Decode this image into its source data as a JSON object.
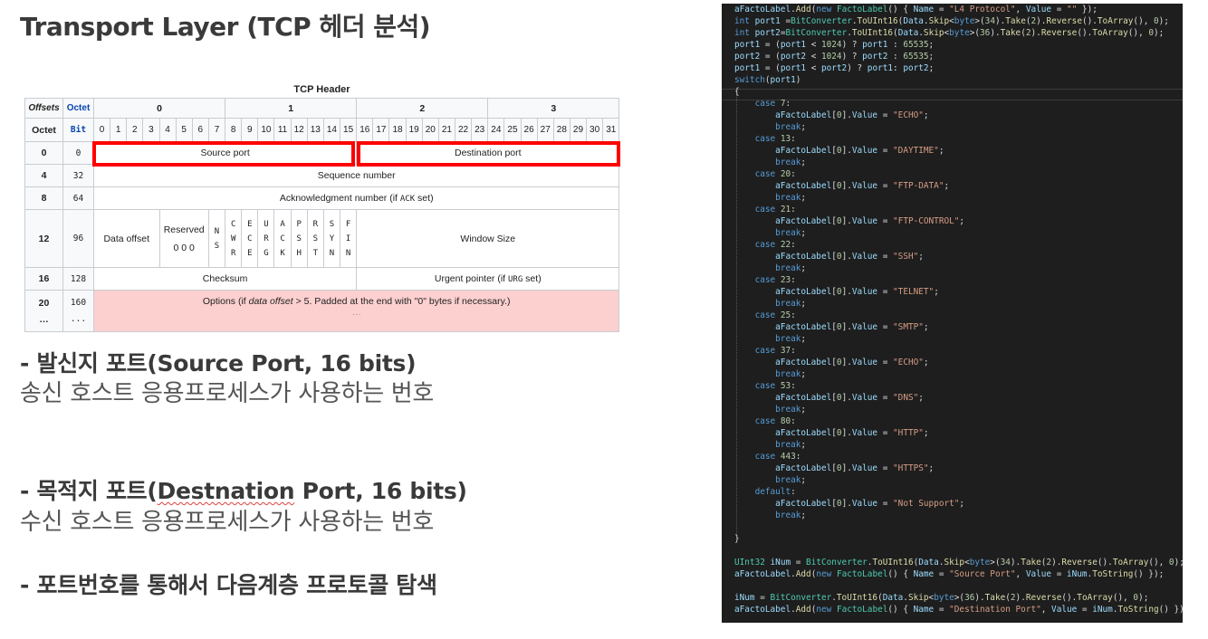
{
  "title": "Transport Layer (TCP 헤더 분석)",
  "tcp_table": {
    "caption": "TCP Header",
    "corner_offsets": "Offsets",
    "corner_octet": "Octet",
    "octet_row_label": "Octet",
    "bit_row_label": "Bit",
    "octet_numbers": [
      "0",
      "1",
      "2",
      "3"
    ],
    "bits": [
      "0",
      "1",
      "2",
      "3",
      "4",
      "5",
      "6",
      "7",
      "8",
      "9",
      "10",
      "11",
      "12",
      "13",
      "14",
      "15",
      "16",
      "17",
      "18",
      "19",
      "20",
      "21",
      "22",
      "23",
      "24",
      "25",
      "26",
      "27",
      "28",
      "29",
      "30",
      "31"
    ],
    "rows": [
      {
        "octet": "0",
        "bit": "0"
      },
      {
        "octet": "4",
        "bit": "32"
      },
      {
        "octet": "8",
        "bit": "64"
      },
      {
        "octet": "12",
        "bit": "96"
      },
      {
        "octet": "16",
        "bit": "128"
      },
      {
        "octet": "20",
        "bit": "160"
      }
    ],
    "ellipsis": "...",
    "ellipsis_alt": "…",
    "source_port": "Source port",
    "destination_port": "Destination port",
    "sequence_number": "Sequence number",
    "ack_number": "Acknowledgment number (if ",
    "ack_flag": "ACK",
    "ack_suffix": " set)",
    "data_offset": "Data offset",
    "reserved": "Reserved",
    "reserved_bits": "0 0 0",
    "ns_flag": [
      "N",
      "S"
    ],
    "flags": [
      [
        "C",
        "W",
        "R"
      ],
      [
        "E",
        "C",
        "E"
      ],
      [
        "U",
        "R",
        "G"
      ],
      [
        "A",
        "C",
        "K"
      ],
      [
        "P",
        "S",
        "H"
      ],
      [
        "R",
        "S",
        "T"
      ],
      [
        "S",
        "Y",
        "N"
      ],
      [
        "F",
        "I",
        "N"
      ]
    ],
    "window_size": "Window Size",
    "checksum": "Checksum",
    "urgent_pointer": "Urgent pointer (if ",
    "urg_flag": "URG",
    "urgent_suffix": " set)",
    "options_prefix": "Options (if ",
    "options_italic": "data offset",
    "options_suffix": " > 5. Padded at the end with \"0\" bytes if necessary.)",
    "highlight_color": "#ff0000",
    "options_bg": "#fdd0d0"
  },
  "sections": {
    "source_heading": "- 발신지 포트(Source Port, 16 bits)",
    "source_desc": "송신 호스트 응용프로세스가 사용하는 번호",
    "dest_heading_pre": "- 목적지 포트(",
    "dest_heading_word": "Destnation",
    "dest_heading_post": " Port, 16 bits)",
    "dest_desc": "수신 호스트 응용프로세스가 사용하는 번호",
    "port_heading": "- 포트번호를 통해서 다음계층 프로토콜 탐색"
  },
  "code": {
    "lines": [
      "aFactoLabel.Add(new FactoLabel() { Name = \"L4 Protocol\", Value = \"\" });",
      "int port1 =BitConverter.ToUInt16(Data.Skip<byte>(34).Take(2).Reverse().ToArray(), 0);",
      "int port2=BitConverter.ToUInt16(Data.Skip<byte>(36).Take(2).Reverse().ToArray(), 0);",
      "port1 = (port1 < 1024) ? port1 : 65535;",
      "port2 = (port2 < 1024) ? port2 : 65535;",
      "port1 = (port1 < port2) ? port1: port2;",
      "switch(port1)",
      "{",
      "    case 7:",
      "        aFactoLabel[0].Value = \"ECHO\";",
      "        break;",
      "    case 13:",
      "        aFactoLabel[0].Value = \"DAYTIME\";",
      "        break;",
      "    case 20:",
      "        aFactoLabel[0].Value = \"FTP-DATA\";",
      "        break;",
      "    case 21:",
      "        aFactoLabel[0].Value = \"FTP-CONTROL\";",
      "        break;",
      "    case 22:",
      "        aFactoLabel[0].Value = \"SSH\";",
      "        break;",
      "    case 23:",
      "        aFactoLabel[0].Value = \"TELNET\";",
      "        break;",
      "    case 25:",
      "        aFactoLabel[0].Value = \"SMTP\";",
      "        break;",
      "    case 37:",
      "        aFactoLabel[0].Value = \"ECHO\";",
      "        break;",
      "    case 53:",
      "        aFactoLabel[0].Value = \"DNS\";",
      "        break;",
      "    case 80:",
      "        aFactoLabel[0].Value = \"HTTP\";",
      "        break;",
      "    case 443:",
      "        aFactoLabel[0].Value = \"HTTPS\";",
      "        break;",
      "    default:",
      "        aFactoLabel[0].Value = \"Not Support\";",
      "        break;",
      "",
      "}",
      "",
      "UInt32 iNum = BitConverter.ToUInt16(Data.Skip<byte>(34).Take(2).Reverse().ToArray(), 0);",
      "aFactoLabel.Add(new FactoLabel() { Name = \"Source Port\", Value = iNum.ToString() });",
      "",
      "iNum = BitConverter.ToUInt16(Data.Skip<byte>(36).Take(2).Reverse().ToArray(), 0);",
      "aFactoLabel.Add(new FactoLabel() { Name = \"Destination Port\", Value = iNum.ToString() });"
    ],
    "line_tops": [
      4,
      17,
      30,
      43,
      56,
      69,
      82,
      95,
      108,
      121,
      134,
      147,
      160,
      173,
      186,
      199,
      212,
      225,
      238,
      251,
      264,
      277,
      290,
      303,
      316,
      329,
      342,
      355,
      368,
      381,
      394,
      407,
      420,
      433,
      446,
      459,
      472,
      485,
      498,
      511,
      524,
      537,
      550,
      563,
      576,
      589,
      602,
      615,
      628,
      641,
      654,
      667
    ]
  }
}
